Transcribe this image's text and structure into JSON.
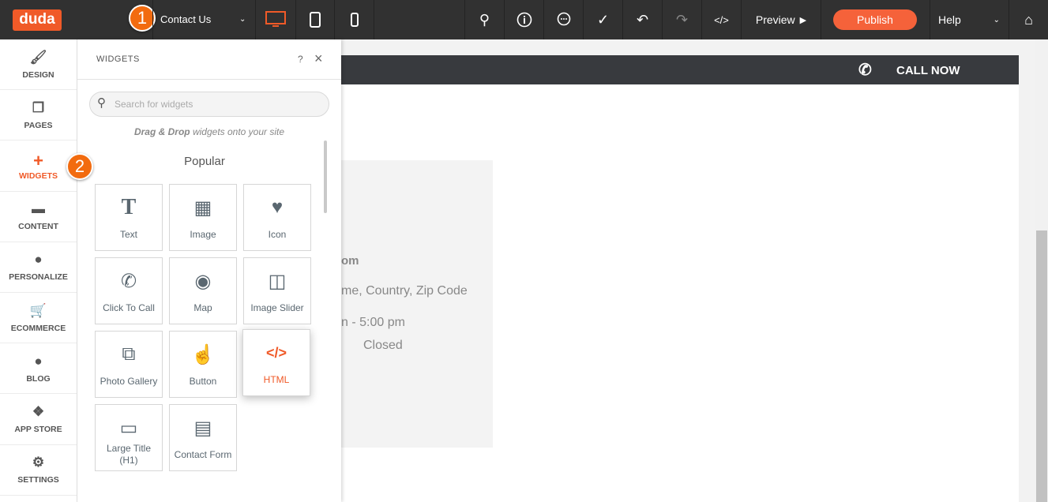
{
  "topbar": {
    "logo": "duda",
    "step1": "1",
    "page": "Contact Us",
    "preview": "Preview",
    "publish": "Publish",
    "help": "Help"
  },
  "sidebar": {
    "step2": "2",
    "items": [
      {
        "label": "DESIGN"
      },
      {
        "label": "PAGES"
      },
      {
        "label": "WIDGETS"
      },
      {
        "label": "CONTENT"
      },
      {
        "label": "PERSONALIZE"
      },
      {
        "label": "ECOMMERCE"
      },
      {
        "label": "BLOG"
      },
      {
        "label": "APP STORE"
      },
      {
        "label": "SETTINGS"
      }
    ]
  },
  "panel": {
    "title": "WIDGETS",
    "help": "?",
    "search_placeholder": "Search for widgets",
    "hint_bold": "Drag & Drop",
    "hint_rest": " widgets onto your site",
    "section": "Popular",
    "widgets": [
      {
        "label": "Text"
      },
      {
        "label": "Image"
      },
      {
        "label": "Icon"
      },
      {
        "label": "Click To Call"
      },
      {
        "label": "Map"
      },
      {
        "label": "Image Slider"
      },
      {
        "label": "Photo Gallery"
      },
      {
        "label": "Button"
      },
      {
        "label": "HTML"
      },
      {
        "label": "Large Title (H1)"
      },
      {
        "label": "Contact Form"
      }
    ]
  },
  "site": {
    "call_now": "CALL NOW",
    "email_fragment": "om",
    "address_fragment": "me, Country, Zip Code",
    "hours_fragment": "n - 5:00 pm",
    "closed": "Closed"
  },
  "colors": {
    "accent": "#f05a28",
    "topbar": "#313131"
  }
}
